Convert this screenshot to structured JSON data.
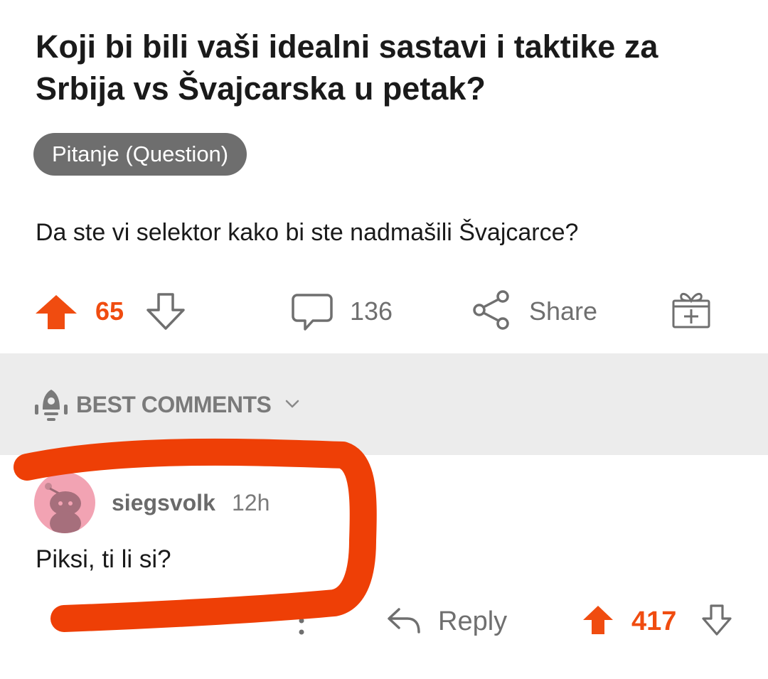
{
  "post": {
    "title": "Koji bi bili vaši idealni sastavi i taktike za Srbija vs Švajcarska u petak?",
    "flair": "Pitanje (Question)",
    "body": "Da ste vi selektor kako bi ste nadmašili Švajcarce?"
  },
  "actions": {
    "upvote_count": "65",
    "comment_count": "136",
    "share_label": "Share"
  },
  "comments_sort": {
    "label": "BEST COMMENTS"
  },
  "comment": {
    "author": "siegsvolk",
    "age": "12h",
    "text": "Piksi, ti li si?",
    "reply_label": "Reply",
    "score": "417"
  },
  "colors": {
    "upvote_accent": "#f04c10",
    "annotation_scribble": "#ee3f06",
    "sort_bar_background": "#ececec",
    "flair_background": "#6e6e6e",
    "avatar_background": "#f2a3b3"
  },
  "icons": {
    "post_upvote": "arrow-up-filled-icon",
    "post_downvote": "arrow-down-outline-icon",
    "comments": "speech-bubble-icon",
    "share": "share-nodes-icon",
    "award": "gift-icon",
    "sort": "rocket-icon",
    "sort_dropdown": "chevron-down-icon",
    "overflow": "vertical-dots-icon",
    "reply": "reply-arrow-icon",
    "comment_upvote": "arrow-up-filled-icon",
    "comment_downvote": "arrow-down-outline-icon"
  }
}
